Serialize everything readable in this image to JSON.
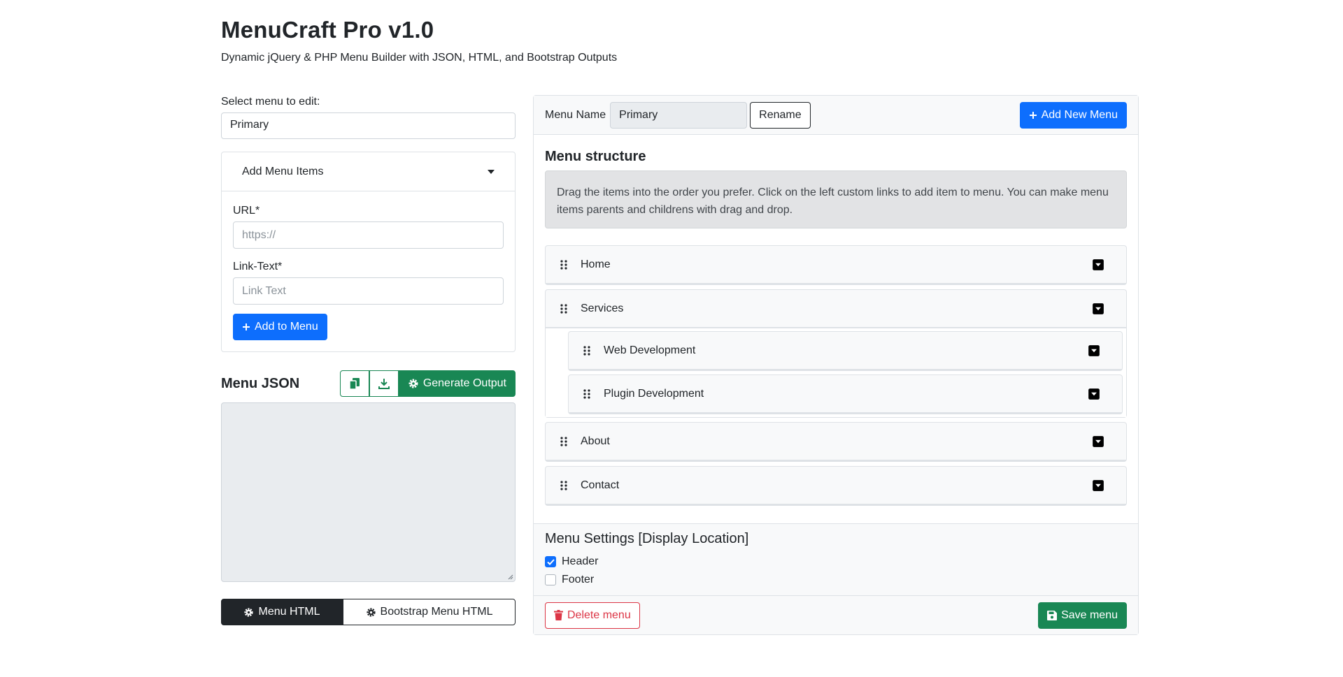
{
  "header": {
    "title": "MenuCraft Pro v1.0",
    "subtitle": "Dynamic jQuery & PHP Menu Builder with JSON, HTML, and Bootstrap Outputs"
  },
  "left": {
    "select_label": "Select menu to edit:",
    "select_value": "Primary",
    "accordion": {
      "title": "Add Menu Items",
      "url_label": "URL*",
      "url_placeholder": "https://",
      "link_label": "Link-Text*",
      "link_placeholder": "Link Text",
      "add_button": "Add to Menu"
    },
    "json": {
      "title": "Menu JSON",
      "generate_button": "Generate Output",
      "value": ""
    },
    "tabs": [
      {
        "label": "Menu HTML",
        "active": true
      },
      {
        "label": "Bootstrap Menu HTML",
        "active": false
      }
    ]
  },
  "editor": {
    "name_label": "Menu Name",
    "name_value": "Primary",
    "rename_button": "Rename",
    "add_new_button": "Add New Menu",
    "structure_title": "Menu structure",
    "info_text": "Drag the items into the order you prefer. Click on the left custom links to add item to menu. You can make menu items parents and childrens with drag and drop.",
    "items": [
      {
        "label": "Home",
        "children": []
      },
      {
        "label": "Services",
        "children": [
          {
            "label": "Web Development"
          },
          {
            "label": "Plugin Development"
          }
        ]
      },
      {
        "label": "About",
        "children": []
      },
      {
        "label": "Contact",
        "children": []
      }
    ],
    "settings": {
      "title": "Menu Settings [Display Location]",
      "locations": [
        {
          "label": "Header",
          "checked": true
        },
        {
          "label": "Footer",
          "checked": false
        }
      ]
    },
    "delete_button": "Delete menu",
    "save_button": "Save menu"
  },
  "colors": {
    "primary": "#0d6efd",
    "success": "#198754",
    "danger": "#dc3545",
    "dark": "#212529"
  },
  "icons": [
    "plus-icon",
    "caret-down-icon",
    "copy-icon",
    "download-icon",
    "gear-icon",
    "grip-icon",
    "trash-icon",
    "save-icon",
    "check-icon"
  ]
}
